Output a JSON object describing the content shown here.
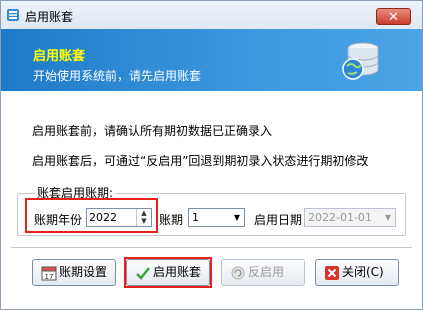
{
  "window": {
    "title": "启用账套",
    "close_glyph": "✕"
  },
  "header": {
    "title": "启用账套",
    "subtitle": "开始使用系统前，请先启用账套",
    "icon": "database-globe-icon"
  },
  "messages": {
    "line1": "启用账套前，请确认所有期初数据已正确录入",
    "line2": "启用账套后，可通过“反启用”回退到期初录入状态进行期初修改"
  },
  "period_group": {
    "label": "账套启用账期:",
    "year_label": "账期年份",
    "year_value": "2022",
    "period_label": "账期",
    "period_value": "1",
    "date_label": "启用日期",
    "date_value": "2022-01-01"
  },
  "buttons": {
    "period_settings": "账期设置",
    "enable": "启用账套",
    "unenable": "反启用",
    "close": "关闭(C)"
  },
  "colors": {
    "header_bg": "#2b8ad6",
    "header_title": "#ffff00",
    "highlight": "#e8211b"
  }
}
